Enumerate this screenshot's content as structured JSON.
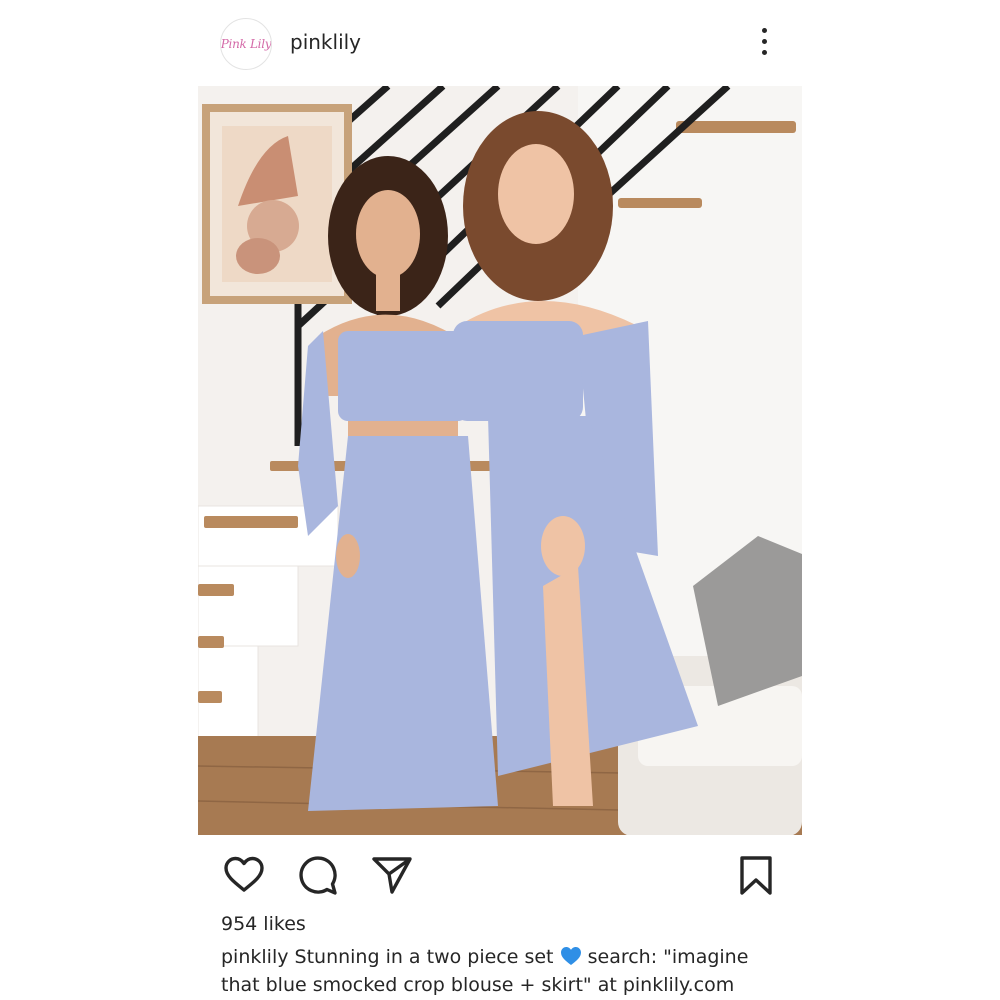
{
  "post": {
    "account": {
      "avatar_text": "Pink Lily",
      "username": "pinklily"
    },
    "likes_text": "954 likes",
    "caption": {
      "username": "pinklily",
      "text_before_emoji": "Stunning in a two piece set",
      "emoji": "blue-heart-emoji",
      "text_after_emoji": "search: \"imagine that blue smocked crop blouse + skirt\" at pinklily.com"
    },
    "icons": {
      "more": "more-options-icon",
      "like": "heart-icon",
      "comment": "comment-bubble-icon",
      "share": "send-paper-plane-icon",
      "save": "bookmark-icon"
    },
    "colors": {
      "text": "#262626",
      "brand_pink": "#d46aa8",
      "outfit_blue": "#a9b6de",
      "emoji_blue": "#2f8fe6"
    }
  }
}
